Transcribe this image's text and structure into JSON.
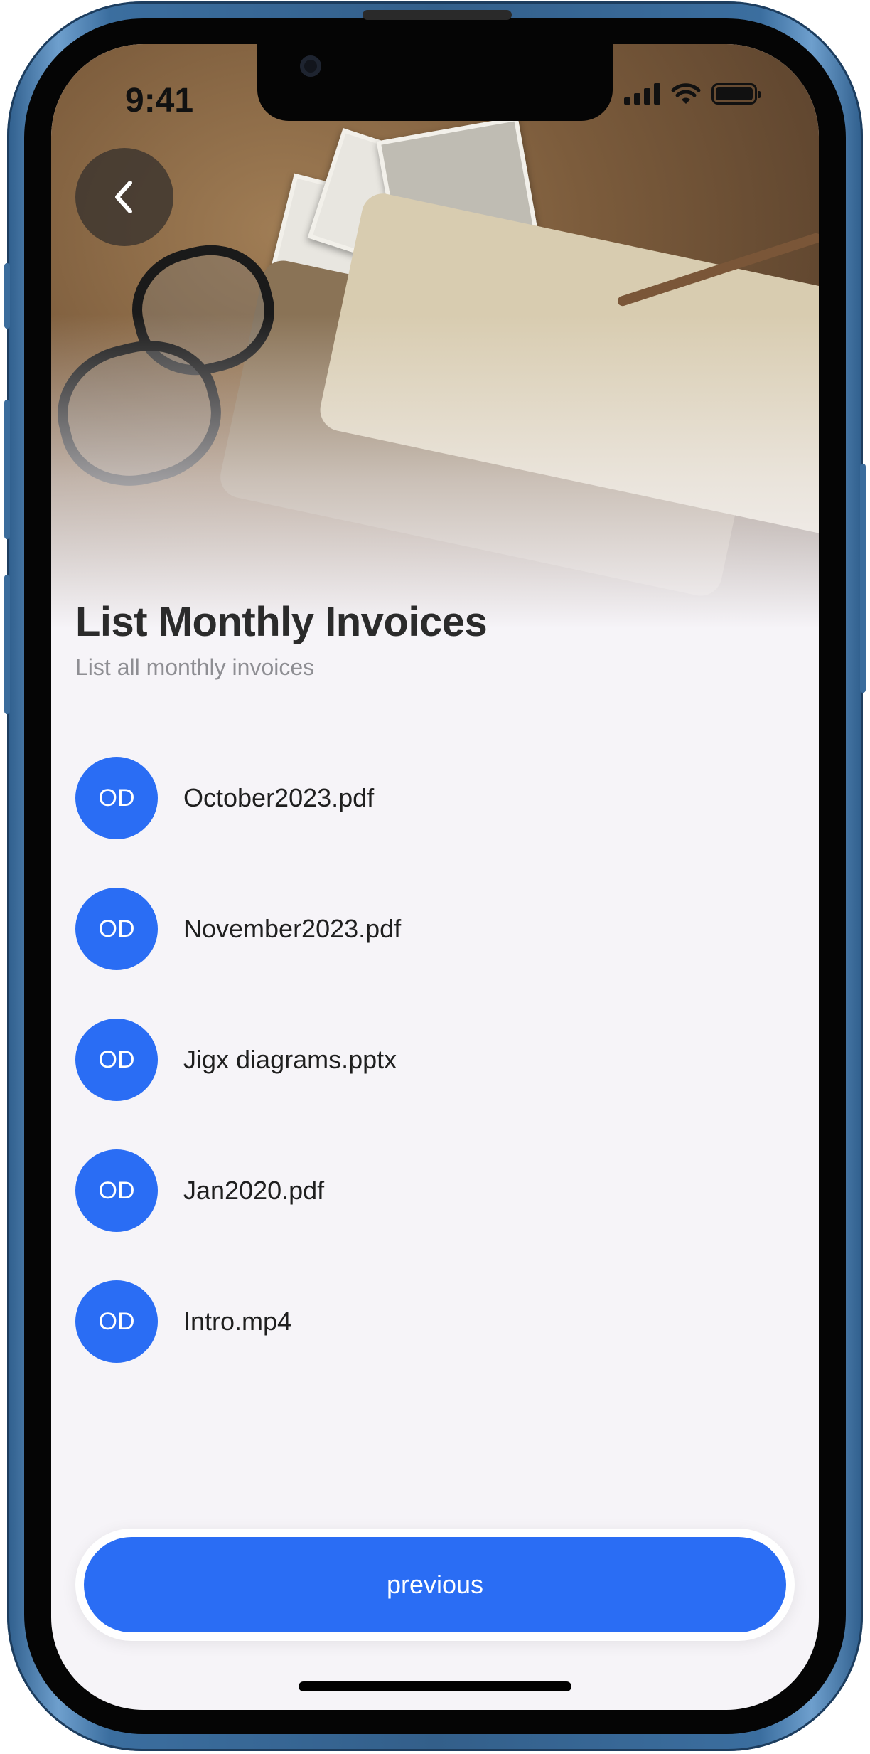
{
  "status_bar": {
    "time": "9:41",
    "icons": [
      "cellular-signal-icon",
      "wifi-icon",
      "battery-icon"
    ]
  },
  "hero": {
    "image": "desk-with-notebook-glasses-photos"
  },
  "back_button": {
    "icon": "chevron-left-icon"
  },
  "header": {
    "title": "List Monthly Invoices",
    "subtitle": "List all monthly invoices"
  },
  "files": [
    {
      "initials": "OD",
      "name": "October2023.pdf"
    },
    {
      "initials": "OD",
      "name": "November2023.pdf"
    },
    {
      "initials": "OD",
      "name": "Jigx diagrams.pptx"
    },
    {
      "initials": "OD",
      "name": "Jan2020.pdf"
    },
    {
      "initials": "OD",
      "name": "Intro.mp4"
    }
  ],
  "footer": {
    "previous_label": "previous"
  },
  "colors": {
    "accent": "#2a6df4",
    "background": "#f6f4f8",
    "title": "#2b2b2b",
    "subtitle": "#8e8e93",
    "device_frame": "#3b6e9f"
  }
}
